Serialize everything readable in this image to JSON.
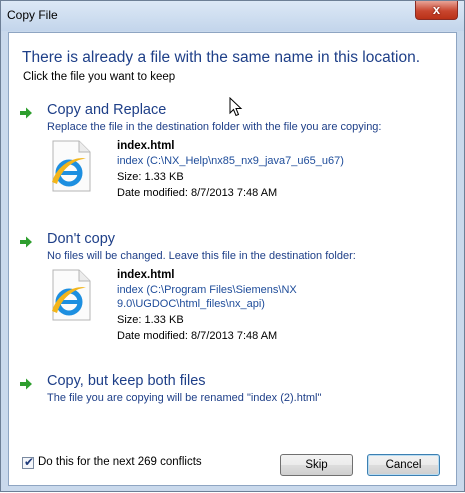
{
  "window": {
    "title": "Copy File",
    "close_glyph": "x"
  },
  "dialog": {
    "heading": "There is already a file with the same name in this location.",
    "subheading": "Click the file you want to keep"
  },
  "options": [
    {
      "title": "Copy and Replace",
      "description": "Replace the file in the destination folder with the file you are copying:",
      "file": {
        "name": "index.html",
        "path_lines": [
          "index (C:\\NX_Help\\nx85_nx9_java7_u65_u67)"
        ],
        "size": "Size: 1.33 KB",
        "modified": "Date modified: 8/7/2013 7:48 AM",
        "icon": "ie-html-file-icon"
      }
    },
    {
      "title": "Don't copy",
      "description": "No files will be changed. Leave this file in the destination folder:",
      "file": {
        "name": "index.html",
        "path_lines": [
          "index (C:\\Program Files\\Siemens\\NX",
          "9.0\\UGDOC\\html_files\\nx_api)"
        ],
        "size": "Size: 1.33 KB",
        "modified": "Date modified: 8/7/2013 7:48 AM",
        "icon": "ie-html-file-icon"
      }
    },
    {
      "title": "Copy, but keep both files",
      "description": "The file you are copying will be renamed \"index (2).html\""
    }
  ],
  "footer": {
    "checkbox_checked": true,
    "checkbox_label": "Do this for the next 269 conflicts",
    "skip_label": "Skip",
    "cancel_label": "Cancel"
  },
  "colors": {
    "accent": "#1e3f88",
    "arrow": "#2e9e2e",
    "link": "#1e4c9a"
  }
}
